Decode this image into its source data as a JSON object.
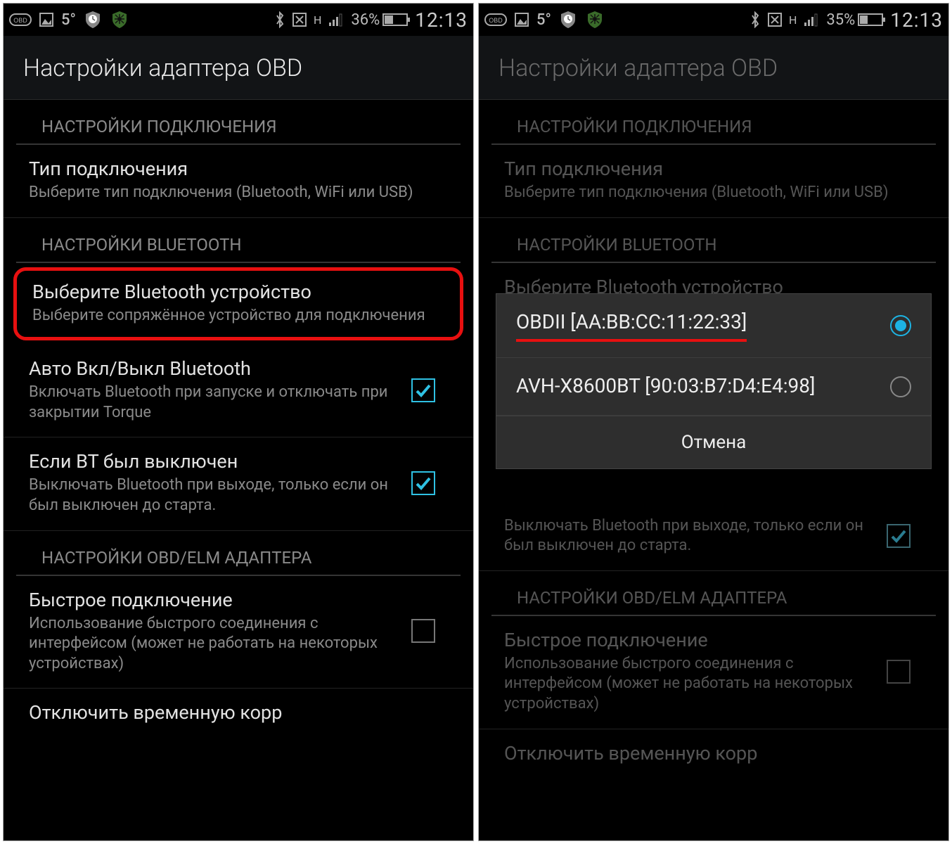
{
  "left": {
    "statusbar": {
      "temp": "5°",
      "h": "H",
      "battery": "36%",
      "time": "12:13",
      "battery_pct": 36
    },
    "title": "Настройки адаптера OBD",
    "sections": {
      "conn_header": "НАСТРОЙКИ ПОДКЛЮЧЕНИЯ",
      "conn_type_title": "Тип подключения",
      "conn_type_sub": "Выберите тип подключения (Bluetooth, WiFi или USB)",
      "bt_header": "НАСТРОЙКИ BLUETOOTH",
      "select_bt_title": "Выберите Bluetooth устройство",
      "select_bt_sub": "Выберите сопряжённое устройство для подключения",
      "auto_bt_title": "Авто Вкл/Выкл Bluetooth",
      "auto_bt_sub": "Включать Bluetooth при запуске и отключать при закрытии Torque",
      "if_off_title": "Если BT был выключен",
      "if_off_sub": "Выключать Bluetooth при выходе, только если он был выключен до старта.",
      "elm_header": "НАСТРОЙКИ OBD/ELM АДАПТЕРА",
      "fast_title": "Быстрое подключение",
      "fast_sub": "Использование быстрого соединения с интерфейсом (может не работать на некоторых устройствах)",
      "disable_title": "Отключить временную корр"
    }
  },
  "right": {
    "statusbar": {
      "temp": "5°",
      "h": "H",
      "battery": "35%",
      "time": "12:13",
      "battery_pct": 35
    },
    "title": "Настройки адаптера OBD",
    "sections": {
      "conn_header": "НАСТРОЙКИ ПОДКЛЮЧЕНИЯ",
      "conn_type_title": "Тип подключения",
      "conn_type_sub": "Выберите тип подключения (Bluetooth, WiFi или USB)",
      "bt_header": "НАСТРОЙКИ BLUETOOTH",
      "select_bt_title": "Выберите Bluetooth устройство",
      "if_off_sub": "Выключать Bluetooth при выходе, только если он был выключен до старта.",
      "elm_header": "НАСТРОЙКИ OBD/ELM АДАПТЕРА",
      "fast_title": "Быстрое подключение",
      "fast_sub": "Использование быстрого соединения с интерфейсом (может не работать на некоторых устройствах)",
      "disable_title": "Отключить временную корр"
    },
    "dialog": {
      "opt1": "OBDII [AA:BB:CC:11:22:33]",
      "opt2": "AVH-X8600BT [90:03:B7:D4:E4:98]",
      "cancel": "Отмена"
    }
  }
}
